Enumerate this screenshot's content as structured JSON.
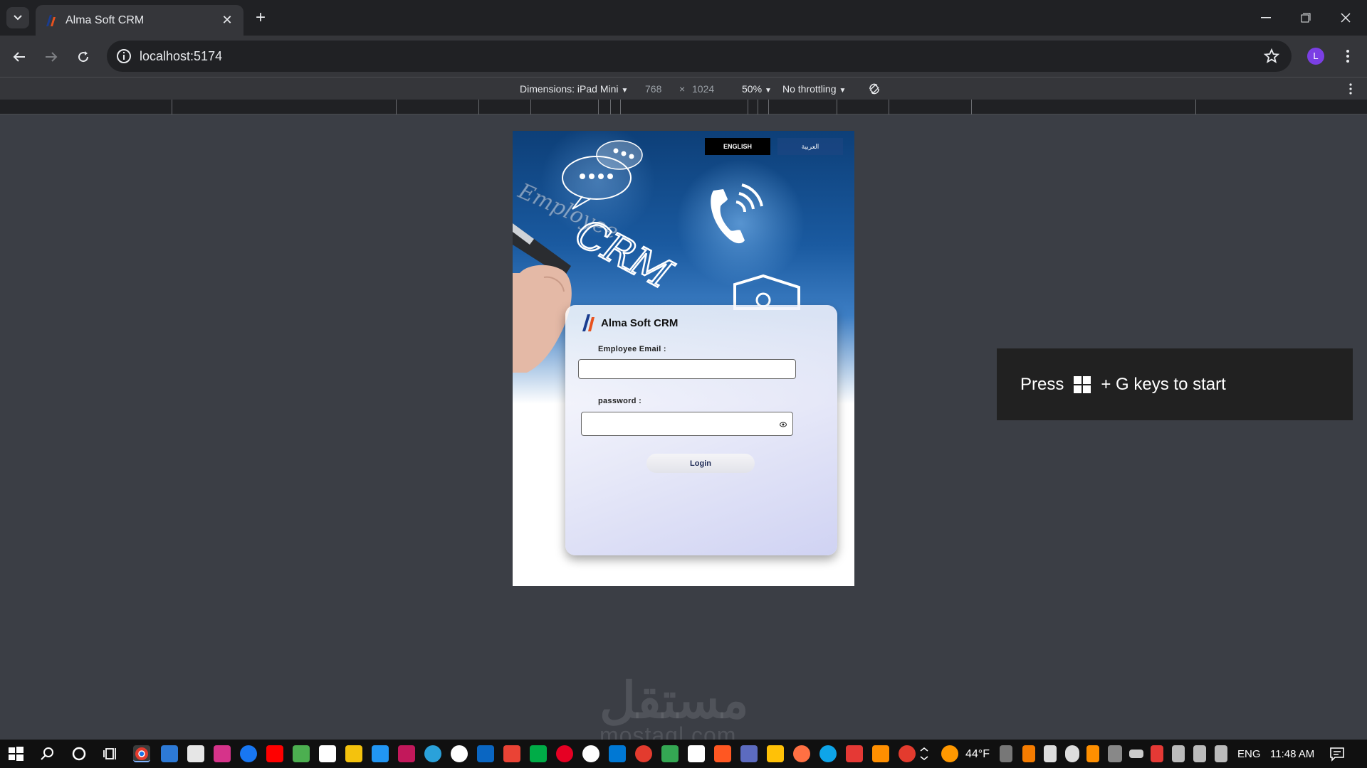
{
  "browser": {
    "tab_title": "Alma Soft CRM",
    "url": "localhost:5174",
    "profile_initial": "L"
  },
  "devtools": {
    "dimensions_label": "Dimensions: iPad Mini",
    "width": "768",
    "times": "×",
    "height": "1024",
    "zoom": "50%",
    "throttling": "No throttling"
  },
  "app": {
    "lang_english": "ENGLISH",
    "lang_arabic": "العربية",
    "brand_name": "Alma Soft CRM",
    "email_label": "Employee Email :",
    "password_label": "password :",
    "login_label": "Login",
    "email_value": "",
    "password_value": ""
  },
  "toast": {
    "prefix": "Press",
    "suffix": "+ G keys to start"
  },
  "watermark": {
    "arabic": "مستقل",
    "latin": "mostaql.com"
  },
  "taskbar": {
    "weather": "44°F",
    "language": "ENG",
    "time": "11:48 AM"
  },
  "colors": {
    "accent_purple": "#7b3fe4",
    "login_text": "#1e2a55"
  }
}
